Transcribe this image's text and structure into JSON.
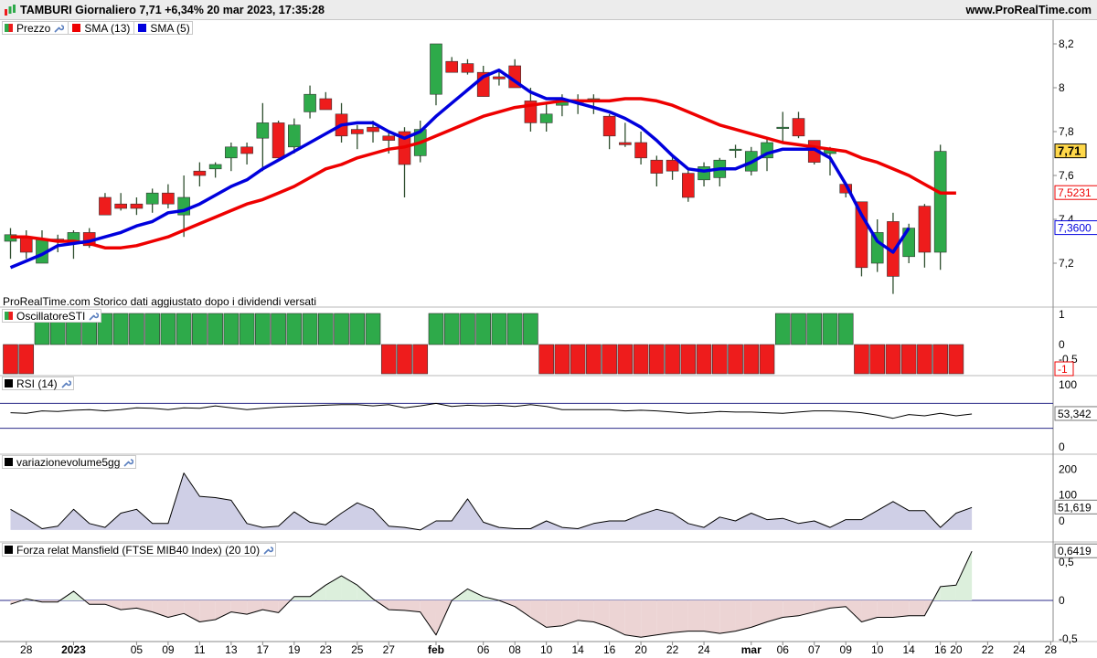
{
  "header": {
    "title": "TAMBURI Giornaliero 7,71 +6,34% 20 mar 2023, 17:35:28",
    "site": "www.ProRealTime.com"
  },
  "legends": {
    "price": "Prezzo",
    "sma13": "SMA (13)",
    "sma5": "SMA (5)",
    "sti": "OscillatoreSTI",
    "rsi": "RSI (14)",
    "vol": "variazionevolume5gg",
    "mansfield": "Forza relat Mansfield (FTSE MIB40 Index) (20 10)"
  },
  "note": "ProRealTime.com  Storico dati aggiustato dopo i dividendi versati",
  "colors": {
    "up": "#2eaa4a",
    "down": "#ee1c1c",
    "sma13": "#ee0000",
    "sma5": "#0000dd",
    "rsi_band": "#2b2b8a",
    "vol_fill": "#cfcfe6",
    "pos_fill": "#dcefdc",
    "neg_fill": "#ecd4d4"
  },
  "chart_data": [
    {
      "type": "candlestick",
      "name": "price",
      "ylim": [
        7.02,
        8.26
      ],
      "yticks": [
        "8,2",
        "8",
        "7,8",
        "7,6",
        "7,4",
        "7,2"
      ],
      "last_labels": {
        "price": "7,71",
        "sma13": "7,5231",
        "sma5": "7,3600"
      },
      "candles": [
        [
          7.3,
          7.36,
          7.22,
          7.33
        ],
        [
          7.32,
          7.35,
          7.22,
          7.25
        ],
        [
          7.2,
          7.35,
          7.2,
          7.31
        ],
        [
          7.31,
          7.33,
          7.25,
          7.3
        ],
        [
          7.3,
          7.35,
          7.22,
          7.34
        ],
        [
          7.34,
          7.36,
          7.27,
          7.28
        ],
        [
          7.5,
          7.52,
          7.45,
          7.42
        ],
        [
          7.47,
          7.52,
          7.44,
          7.45
        ],
        [
          7.47,
          7.5,
          7.42,
          7.45
        ],
        [
          7.47,
          7.54,
          7.43,
          7.52
        ],
        [
          7.52,
          7.56,
          7.45,
          7.47
        ],
        [
          7.42,
          7.6,
          7.32,
          7.5
        ],
        [
          7.62,
          7.66,
          7.55,
          7.6
        ],
        [
          7.63,
          7.66,
          7.59,
          7.65
        ],
        [
          7.68,
          7.75,
          7.62,
          7.73
        ],
        [
          7.73,
          7.75,
          7.65,
          7.7
        ],
        [
          7.77,
          7.93,
          7.62,
          7.84
        ],
        [
          7.84,
          7.85,
          7.7,
          7.68
        ],
        [
          7.73,
          7.86,
          7.7,
          7.83
        ],
        [
          7.89,
          8.01,
          7.86,
          7.97
        ],
        [
          7.95,
          7.98,
          7.9,
          7.9
        ],
        [
          7.88,
          7.93,
          7.75,
          7.78
        ],
        [
          7.81,
          7.83,
          7.72,
          7.79
        ],
        [
          7.82,
          7.85,
          7.75,
          7.8
        ],
        [
          7.78,
          7.8,
          7.7,
          7.76
        ],
        [
          7.8,
          7.82,
          7.5,
          7.65
        ],
        [
          7.69,
          7.85,
          7.66,
          7.81
        ],
        [
          7.97,
          8.2,
          7.92,
          8.2
        ],
        [
          8.12,
          8.14,
          8.07,
          8.07
        ],
        [
          8.11,
          8.13,
          8.06,
          8.07
        ],
        [
          8.07,
          8.1,
          7.96,
          7.96
        ],
        [
          8.05,
          8.08,
          8.01,
          8.04
        ],
        [
          8.1,
          8.13,
          8.03,
          8.0
        ],
        [
          7.94,
          8.0,
          7.8,
          7.84
        ],
        [
          7.84,
          7.93,
          7.8,
          7.88
        ],
        [
          7.92,
          7.97,
          7.87,
          7.94
        ],
        [
          7.94,
          7.97,
          7.88,
          7.94
        ],
        [
          7.94,
          7.97,
          7.88,
          7.95
        ],
        [
          7.87,
          7.88,
          7.72,
          7.78
        ],
        [
          7.75,
          7.84,
          7.73,
          7.74
        ],
        [
          7.75,
          7.8,
          7.65,
          7.68
        ],
        [
          7.67,
          7.69,
          7.55,
          7.61
        ],
        [
          7.67,
          7.69,
          7.58,
          7.62
        ],
        [
          7.61,
          7.63,
          7.48,
          7.5
        ],
        [
          7.58,
          7.66,
          7.55,
          7.64
        ],
        [
          7.59,
          7.68,
          7.55,
          7.67
        ],
        [
          7.72,
          7.74,
          7.68,
          7.72
        ],
        [
          7.62,
          7.73,
          7.6,
          7.71
        ],
        [
          7.68,
          7.77,
          7.62,
          7.75
        ],
        [
          7.82,
          7.89,
          7.75,
          7.82
        ],
        [
          7.86,
          7.89,
          7.77,
          7.78
        ],
        [
          7.76,
          7.76,
          7.65,
          7.66
        ],
        [
          7.7,
          7.73,
          7.6,
          7.72
        ],
        [
          7.56,
          7.57,
          7.5,
          7.52
        ],
        [
          7.48,
          7.48,
          7.14,
          7.18
        ],
        [
          7.2,
          7.4,
          7.16,
          7.34
        ],
        [
          7.39,
          7.43,
          7.06,
          7.14
        ],
        [
          7.23,
          7.38,
          7.2,
          7.36
        ],
        [
          7.46,
          7.47,
          7.18,
          7.25
        ],
        [
          7.25,
          7.74,
          7.17,
          7.71
        ]
      ],
      "sma13": [
        7.32,
        7.32,
        7.31,
        7.3,
        7.3,
        7.29,
        7.27,
        7.27,
        7.28,
        7.3,
        7.32,
        7.35,
        7.38,
        7.41,
        7.44,
        7.47,
        7.49,
        7.52,
        7.55,
        7.59,
        7.63,
        7.65,
        7.68,
        7.7,
        7.72,
        7.73,
        7.75,
        7.78,
        7.81,
        7.84,
        7.87,
        7.89,
        7.91,
        7.92,
        7.93,
        7.94,
        7.94,
        7.94,
        7.94,
        7.95,
        7.95,
        7.94,
        7.92,
        7.89,
        7.86,
        7.83,
        7.81,
        7.79,
        7.77,
        7.75,
        7.74,
        7.73,
        7.72,
        7.71,
        7.68,
        7.66,
        7.63,
        7.6,
        7.56,
        7.52,
        7.52
      ],
      "sma5": [
        7.18,
        7.21,
        7.24,
        7.28,
        7.29,
        7.3,
        7.32,
        7.34,
        7.37,
        7.39,
        7.43,
        7.44,
        7.47,
        7.51,
        7.55,
        7.58,
        7.63,
        7.67,
        7.71,
        7.75,
        7.79,
        7.83,
        7.84,
        7.84,
        7.8,
        7.77,
        7.8,
        7.87,
        7.93,
        7.99,
        8.05,
        8.08,
        8.03,
        7.98,
        7.95,
        7.95,
        7.93,
        7.91,
        7.89,
        7.86,
        7.82,
        7.76,
        7.69,
        7.63,
        7.62,
        7.63,
        7.63,
        7.66,
        7.7,
        7.72,
        7.72,
        7.72,
        7.68,
        7.56,
        7.42,
        7.3,
        7.25,
        7.36
      ]
    },
    {
      "type": "bar",
      "name": "OscillatoreSTI",
      "ylim": [
        -1,
        1
      ],
      "yticks": [
        "1",
        "0",
        "-0,5"
      ],
      "last_label": "-1",
      "values": [
        -1,
        -1,
        1,
        1,
        1,
        1,
        1,
        1,
        1,
        1,
        1,
        1,
        1,
        1,
        1,
        1,
        1,
        1,
        1,
        1,
        1,
        1,
        1,
        1,
        -1,
        -1,
        -1,
        1,
        1,
        1,
        1,
        1,
        1,
        1,
        -1,
        -1,
        -1,
        -1,
        -1,
        -1,
        -1,
        -1,
        -1,
        -1,
        -1,
        -1,
        -1,
        -1,
        -1,
        1,
        1,
        1,
        1,
        1,
        -1,
        -1,
        -1,
        -1,
        -1,
        -1,
        -1
      ]
    },
    {
      "type": "line",
      "name": "RSI (14)",
      "ylim": [
        0,
        100
      ],
      "yticks": [
        "100",
        "0"
      ],
      "bands": [
        70,
        30
      ],
      "last_label": "53,342",
      "values": [
        55,
        54,
        58,
        57,
        59,
        60,
        58,
        60,
        63,
        62,
        60,
        63,
        62,
        66,
        63,
        60,
        62,
        64,
        65,
        66,
        67,
        68,
        68,
        66,
        68,
        63,
        66,
        70,
        65,
        67,
        66,
        67,
        65,
        68,
        65,
        60,
        60,
        60,
        60,
        58,
        59,
        58,
        56,
        54,
        55,
        57,
        56,
        56,
        55,
        54,
        56,
        58,
        58,
        57,
        55,
        51,
        46,
        52,
        50,
        54,
        50,
        53
      ]
    },
    {
      "type": "area",
      "name": "variazionevolume5gg",
      "ylim": [
        -35,
        230
      ],
      "yticks": [
        "200",
        "100",
        "0"
      ],
      "last_label": "51,619",
      "values": [
        45,
        10,
        -30,
        -20,
        45,
        -10,
        -25,
        30,
        45,
        -10,
        -10,
        185,
        95,
        90,
        80,
        -10,
        -25,
        -20,
        35,
        -5,
        -15,
        30,
        70,
        45,
        -20,
        -25,
        -35,
        0,
        0,
        85,
        -5,
        -25,
        -30,
        -30,
        0,
        -25,
        -30,
        -10,
        0,
        0,
        25,
        45,
        30,
        -10,
        -25,
        15,
        0,
        30,
        5,
        10,
        -10,
        0,
        -25,
        5,
        5,
        40,
        75,
        40,
        40,
        -25,
        30,
        52
      ]
    },
    {
      "type": "area",
      "name": "Forza relat Mansfield",
      "ylim": [
        -0.55,
        0.72
      ],
      "yticks": [
        "0,5",
        "0",
        "-0,5"
      ],
      "last_label": "0,6419",
      "values": [
        -0.05,
        0.02,
        -0.02,
        -0.02,
        0.12,
        -0.05,
        -0.05,
        -0.12,
        -0.1,
        -0.15,
        -0.22,
        -0.17,
        -0.28,
        -0.25,
        -0.15,
        -0.18,
        -0.12,
        -0.16,
        0.05,
        0.05,
        0.2,
        0.32,
        0.2,
        0.02,
        -0.12,
        -0.13,
        -0.15,
        -0.45,
        0.0,
        0.15,
        0.05,
        0.0,
        -0.08,
        -0.22,
        -0.35,
        -0.33,
        -0.26,
        -0.28,
        -0.35,
        -0.45,
        -0.48,
        -0.45,
        -0.42,
        -0.4,
        -0.4,
        -0.43,
        -0.4,
        -0.35,
        -0.28,
        -0.22,
        -0.2,
        -0.15,
        -0.1,
        -0.08,
        -0.28,
        -0.22,
        -0.22,
        -0.2,
        -0.2,
        0.18,
        0.2,
        0.64
      ]
    }
  ],
  "x_axis": {
    "labels": [
      {
        "i": 1,
        "t": "28"
      },
      {
        "i": 4,
        "t": "2023",
        "bold": true
      },
      {
        "i": 8,
        "t": "05"
      },
      {
        "i": 10,
        "t": "09"
      },
      {
        "i": 12,
        "t": "11"
      },
      {
        "i": 14,
        "t": "13"
      },
      {
        "i": 16,
        "t": "17"
      },
      {
        "i": 18,
        "t": "19"
      },
      {
        "i": 20,
        "t": "23"
      },
      {
        "i": 22,
        "t": "25"
      },
      {
        "i": 24,
        "t": "27"
      },
      {
        "i": 27,
        "t": "feb",
        "bold": true
      },
      {
        "i": 30,
        "t": "06"
      },
      {
        "i": 32,
        "t": "08"
      },
      {
        "i": 34,
        "t": "10"
      },
      {
        "i": 36,
        "t": "14"
      },
      {
        "i": 38,
        "t": "16"
      },
      {
        "i": 40,
        "t": "20"
      },
      {
        "i": 42,
        "t": "22"
      },
      {
        "i": 44,
        "t": "24"
      },
      {
        "i": 47,
        "t": "mar",
        "bold": true
      },
      {
        "i": 49,
        "t": "06"
      },
      {
        "i": 51,
        "t": "07"
      },
      {
        "i": 53,
        "t": "09"
      },
      {
        "i": 55,
        "t": "10"
      },
      {
        "i": 57,
        "t": "14"
      },
      {
        "i": 59,
        "t": "16"
      },
      {
        "i": 60,
        "t": "20"
      },
      {
        "i": 62,
        "t": "22"
      },
      {
        "i": 64,
        "t": "24"
      },
      {
        "i": 66,
        "t": "28"
      }
    ]
  }
}
